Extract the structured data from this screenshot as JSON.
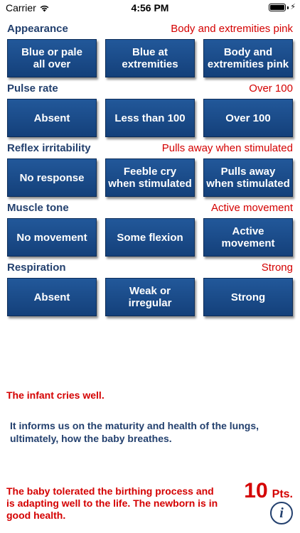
{
  "status": {
    "carrier": "Carrier",
    "time": "4:56 PM"
  },
  "sections": [
    {
      "title": "Appearance",
      "value": "Body and extremities pink",
      "options": [
        "Blue or pale\nall over",
        "Blue at\nextremities",
        "Body and\nextremities pink"
      ]
    },
    {
      "title": "Pulse rate",
      "value": "Over 100",
      "options": [
        "Absent",
        "Less than 100",
        "Over 100"
      ]
    },
    {
      "title": "Reflex irritability",
      "value": "Pulls away when stimulated",
      "options": [
        "No response",
        "Feeble cry\nwhen stimulated",
        "Pulls away\nwhen stimulated"
      ]
    },
    {
      "title": "Muscle tone",
      "value": "Active movement",
      "options": [
        "No movement",
        "Some flexion",
        "Active\nmovement"
      ]
    },
    {
      "title": "Respiration",
      "value": "Strong",
      "options": [
        "Absent",
        "Weak or\nirregular",
        "Strong"
      ]
    }
  ],
  "detail": {
    "headline": "The infant cries well.",
    "info": "It informs us on the maturity and health of the lungs, ultimately, how the baby breathes."
  },
  "result": {
    "text": "The baby tolerated the birthing process and is adapting well to the life. The newborn is in good health.",
    "score": "10",
    "unit": "Pts."
  },
  "icons": {
    "wifi": "wifi-icon",
    "battery": "battery-icon",
    "charging": "charging-bolt-icon",
    "info": "info-icon"
  },
  "colors": {
    "heading": "#23406e",
    "accent_red": "#d40000",
    "button_blue": "#1b4d8c",
    "button_text": "#ffffff"
  }
}
